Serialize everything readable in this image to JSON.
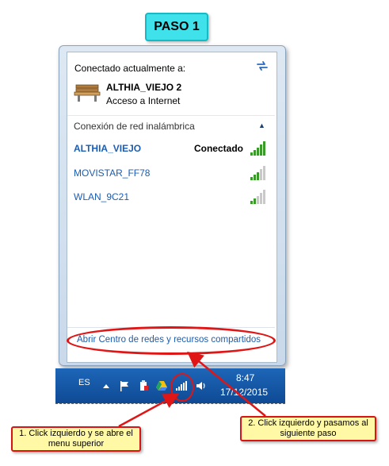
{
  "title_badge": "PASO 1",
  "flyout": {
    "connected_label": "Conectado actualmente a:",
    "current_network": {
      "name": "ALTHIA_VIEJO  2",
      "status": "Acceso a Internet"
    },
    "section_title": "Conexión de red inalámbrica",
    "networks": [
      {
        "ssid": "ALTHIA_VIEJO",
        "state": "Conectado",
        "signal_bars": 5
      },
      {
        "ssid": "MOVISTAR_FF78",
        "state": "",
        "signal_bars": 3
      },
      {
        "ssid": "WLAN_9C21",
        "state": "",
        "signal_bars": 2
      }
    ],
    "footer_link": "Abrir Centro de redes y recursos compartidos"
  },
  "taskbar": {
    "language": "ES",
    "time": "8:47",
    "date": "17/12/2015"
  },
  "notes": {
    "note1": "1. Click izquierdo y se abre el menu superior",
    "note2": "2. Click izquierdo y pasamos al siguiente paso"
  },
  "colors": {
    "accent_cyan": "#3fe1ea",
    "annotation_red": "#e01515",
    "note_yellow": "#fff9a6",
    "link_blue": "#1a5db3",
    "taskbar_blue": "#1d66b8",
    "signal_green": "#3a9a2a"
  },
  "icons": {
    "refresh": "refresh-icon",
    "network": "bench-icon",
    "collapse": "chevron-up-icon",
    "signal": "signal-bars-icon",
    "show_hidden": "triangle-up-icon",
    "action_center": "flag-icon",
    "device": "device-icon",
    "drive": "drive-icon",
    "volume": "speaker-icon"
  }
}
